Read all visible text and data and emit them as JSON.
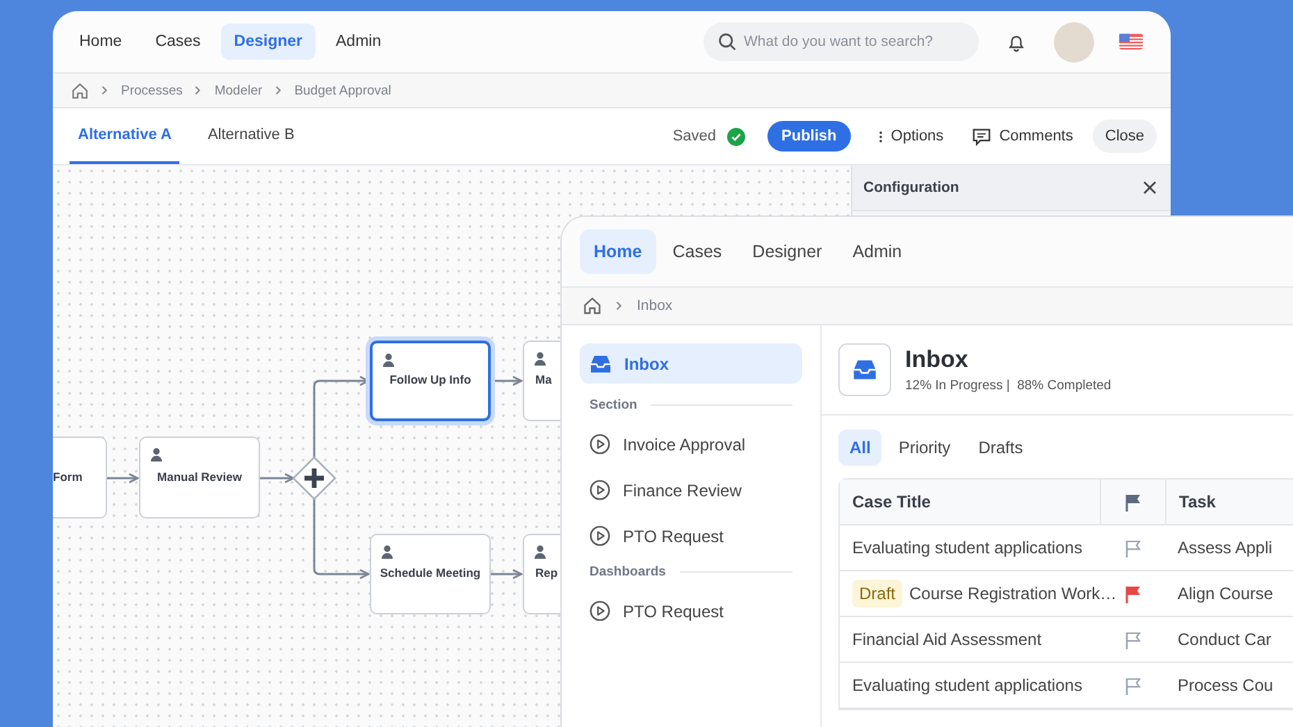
{
  "back_window": {
    "nav_tabs": [
      {
        "label": "Home",
        "selected": false
      },
      {
        "label": "Cases",
        "selected": false
      },
      {
        "label": "Designer",
        "selected": true
      },
      {
        "label": "Admin",
        "selected": false
      }
    ],
    "search": {
      "placeholder": "What do you want to search?"
    },
    "breadcrumb": [
      "Processes",
      "Modeler",
      "Budget Approval"
    ],
    "view_tabs": [
      {
        "label": "Alternative A",
        "selected": true
      },
      {
        "label": "Alternative B",
        "selected": false
      }
    ],
    "save_status": "Saved",
    "actions": {
      "publish": "Publish",
      "options": "Options",
      "comments": "Comments",
      "close": "Close"
    },
    "diagram": {
      "nodes": [
        {
          "label": "Form",
          "selected": false
        },
        {
          "label": "Manual Review",
          "selected": false
        },
        {
          "label": "Follow Up Info",
          "selected": true
        },
        {
          "label": "Ma",
          "selected": false
        },
        {
          "label": "Schedule Meeting",
          "selected": false
        },
        {
          "label": "Rep",
          "selected": false
        }
      ]
    },
    "config_panel": {
      "title": "Configuration"
    }
  },
  "front_window": {
    "nav_tabs": [
      {
        "label": "Home",
        "selected": true
      },
      {
        "label": "Cases",
        "selected": false
      },
      {
        "label": "Designer",
        "selected": false
      },
      {
        "label": "Admin",
        "selected": false
      }
    ],
    "breadcrumb": [
      "Inbox"
    ],
    "sidebar": {
      "top_item": {
        "label": "Inbox",
        "selected": true
      },
      "sections": [
        {
          "title": "Section",
          "items": [
            {
              "label": "Invoice Approval",
              "selected": false
            },
            {
              "label": "Finance Review",
              "selected": false
            },
            {
              "label": "PTO Request",
              "selected": false
            }
          ]
        },
        {
          "title": "Dashboards",
          "items": [
            {
              "label": "PTO Request",
              "selected": false
            }
          ]
        }
      ]
    },
    "header": {
      "title": "Inbox",
      "subtitle": "12% In Progress |  88% Completed"
    },
    "filter_tabs": [
      {
        "label": "All",
        "selected": true
      },
      {
        "label": "Priority",
        "selected": false
      },
      {
        "label": "Drafts",
        "selected": false
      }
    ],
    "table": {
      "columns": [
        "Case Title",
        "Task"
      ],
      "rows": [
        {
          "title": "Evaluating student applications",
          "flagged": false,
          "task": "Assess Appli"
        },
        {
          "badge": "Draft",
          "title": "Course Registration Work…",
          "flagged": true,
          "task": "Align Course"
        },
        {
          "title": "Financial Aid Assessment",
          "flagged": false,
          "task": "Conduct Car"
        },
        {
          "title": "Evaluating student applications",
          "flagged": false,
          "task": "Process Cou"
        }
      ]
    }
  }
}
